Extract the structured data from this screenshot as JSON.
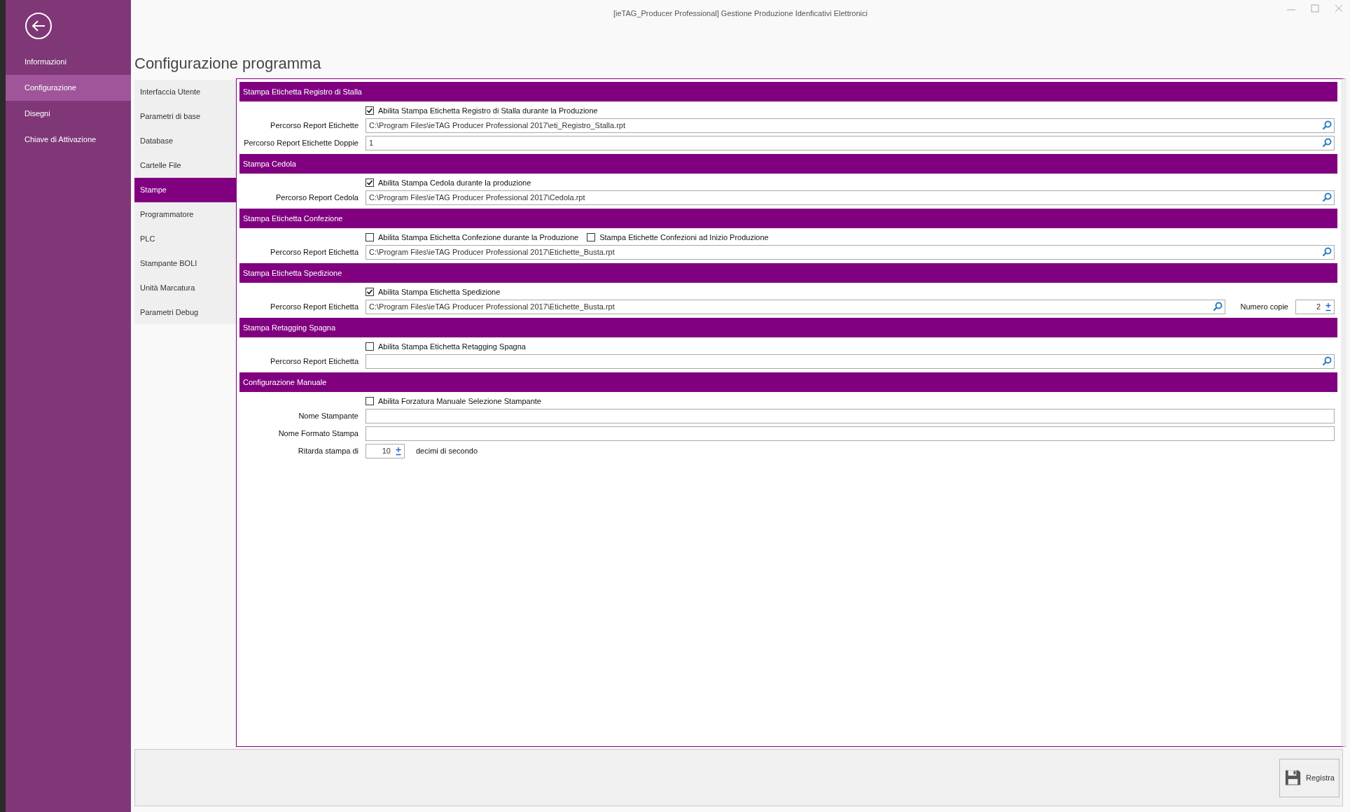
{
  "window": {
    "title": "[ieTAG_Producer Professional] Gestione Produzione Idenficativi Elettronici"
  },
  "sidebar": {
    "items": [
      {
        "label": "Informazioni",
        "selected": false
      },
      {
        "label": "Configurazione",
        "selected": true
      },
      {
        "label": "Disegni",
        "selected": false
      },
      {
        "label": "Chiave di Attivazione",
        "selected": false
      }
    ]
  },
  "page_title": "Configurazione programma",
  "nav": {
    "items": [
      {
        "label": "Interfaccia Utente",
        "selected": false
      },
      {
        "label": "Parametri di base",
        "selected": false
      },
      {
        "label": "Database",
        "selected": false
      },
      {
        "label": "Cartelle File",
        "selected": false
      },
      {
        "label": "Stampe",
        "selected": true
      },
      {
        "label": "Programmatore",
        "selected": false
      },
      {
        "label": "PLC",
        "selected": false
      },
      {
        "label": "Stampante BOLI",
        "selected": false
      },
      {
        "label": "Unità Marcatura",
        "selected": false
      },
      {
        "label": "Parametri Debug",
        "selected": false
      }
    ]
  },
  "sections": [
    {
      "title": "Stampa Etichetta Registro di Stalla",
      "rows": [
        {
          "kind": "checks",
          "checks": [
            {
              "label": "Abilita Stampa Etichetta Registro di Stalla durante la Produzione",
              "checked": true
            }
          ]
        },
        {
          "kind": "path",
          "label": "Percorso Report Etichette",
          "value": "C:\\Program Files\\ieTAG Producer Professional 2017\\eti_Registro_Stalla.rpt"
        },
        {
          "kind": "path",
          "label": "Percorso Report Etichette Doppie",
          "value": "1"
        }
      ]
    },
    {
      "title": "Stampa Cedola",
      "rows": [
        {
          "kind": "checks",
          "checks": [
            {
              "label": "Abilita Stampa Cedola durante la produzione",
              "checked": true
            }
          ]
        },
        {
          "kind": "path",
          "label": "Percorso Report Cedola",
          "value": "C:\\Program Files\\ieTAG Producer Professional 2017\\Cedola.rpt"
        }
      ]
    },
    {
      "title": "Stampa Etichetta Confezione",
      "rows": [
        {
          "kind": "checks",
          "checks": [
            {
              "label": "Abilita Stampa Etichetta Confezione durante la Produzione",
              "checked": false
            },
            {
              "label": "Stampa Etichette Confezioni ad Inizio Produzione",
              "checked": false
            }
          ]
        },
        {
          "kind": "path",
          "label": "Percorso Report Etichetta",
          "value": "C:\\Program Files\\ieTAG Producer Professional 2017\\Etichette_Busta.rpt"
        }
      ]
    },
    {
      "title": "Stampa Etichetta Spedizione",
      "rows": [
        {
          "kind": "checks",
          "checks": [
            {
              "label": "Abilita Stampa Etichetta Spedizione",
              "checked": true
            }
          ]
        },
        {
          "kind": "path",
          "label": "Percorso Report Etichetta",
          "value": "C:\\Program Files\\ieTAG Producer Professional 2017\\Etichette_Busta.rpt",
          "copies": {
            "label": "Numero copie",
            "value": "2"
          }
        }
      ]
    },
    {
      "title": "Stampa Retagging Spagna",
      "rows": [
        {
          "kind": "checks",
          "checks": [
            {
              "label": "Abilita Stampa Etichetta Retagging Spagna",
              "checked": false
            }
          ]
        },
        {
          "kind": "path",
          "label": "Percorso Report Etichetta"
        }
      ]
    },
    {
      "title": "Configurazione Manuale",
      "rows": [
        {
          "kind": "checks",
          "checks": [
            {
              "label": "Abilita Forzatura Manuale Selezione Stampante",
              "checked": false
            }
          ]
        },
        {
          "kind": "text",
          "label": "Nome Stampante"
        },
        {
          "kind": "text",
          "label": "Nome Formato Stampa"
        },
        {
          "kind": "spin",
          "label": "Ritarda stampa di",
          "value": "10",
          "suffix": "decimi di secondo"
        }
      ]
    }
  ],
  "footer": {
    "save_button": "Registra"
  }
}
